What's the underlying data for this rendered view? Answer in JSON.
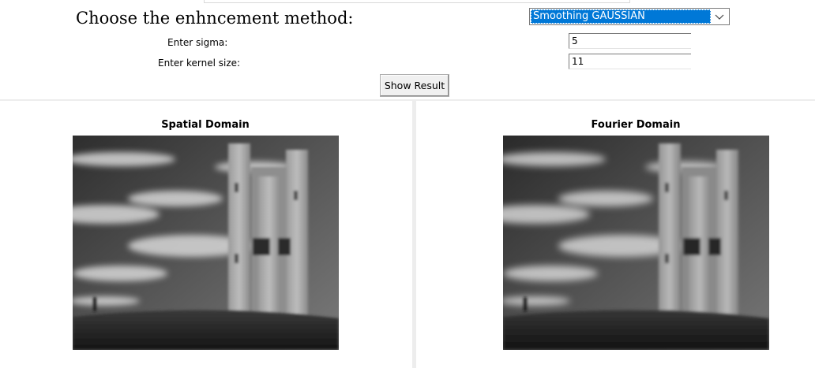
{
  "controls": {
    "heading": "Choose the enhncement method:",
    "method_select": {
      "value": "Smoothing GAUSSIAN",
      "selected_color": "#0078d7"
    },
    "sigma": {
      "label": "Enter sigma:",
      "value": "5"
    },
    "kernel_size": {
      "label": "Enter kernel size:",
      "value": "11"
    },
    "show_button_label": "Show Result"
  },
  "panels": [
    {
      "title": "Spatial Domain",
      "image_icon": "tower-photo-image"
    },
    {
      "title": "Fourier Domain",
      "image_icon": "tower-photo-image"
    }
  ]
}
